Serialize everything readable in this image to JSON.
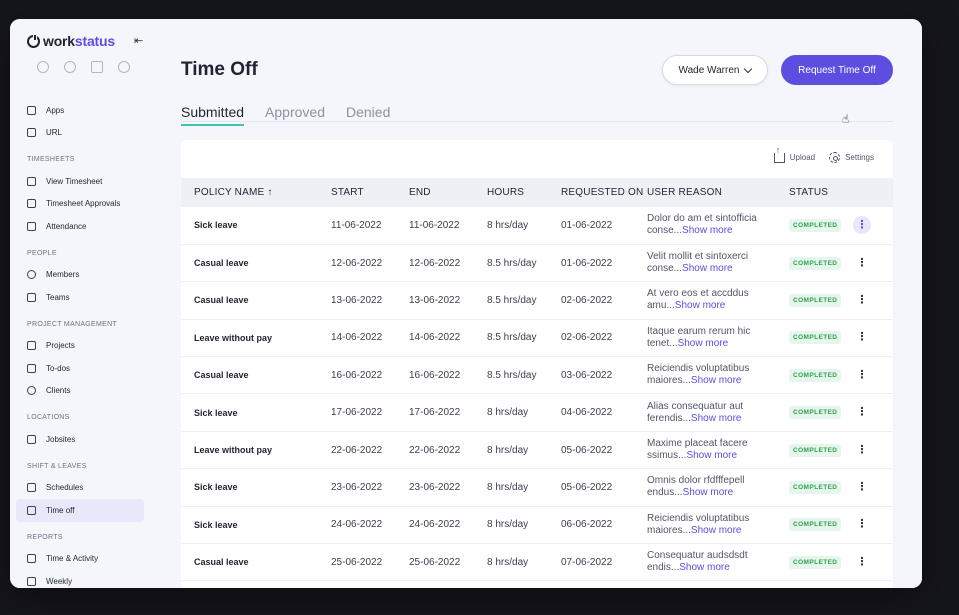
{
  "brand": {
    "name_prefix": "work",
    "name_suffix": "status"
  },
  "sidebar": {
    "top_items": [
      {
        "label": "Apps",
        "icon": "grid-icon"
      },
      {
        "label": "URL",
        "icon": "link-icon"
      }
    ],
    "sections": [
      {
        "title": "TIMESHEETS",
        "items": [
          "View Timesheet",
          "Timesheet Approvals",
          "Attendance"
        ]
      },
      {
        "title": "PEOPLE",
        "items": [
          "Members",
          "Teams"
        ]
      },
      {
        "title": "PROJECT MANAGEMENT",
        "items": [
          "Projects",
          "To-dos",
          "Clients"
        ]
      },
      {
        "title": "LOCATIONS",
        "items": [
          "Jobsites"
        ]
      },
      {
        "title": "SHIFT & LEAVES",
        "items": [
          "Schedules",
          "Time off"
        ]
      },
      {
        "title": "REPORTS",
        "items": [
          "Time & Activity",
          "Weekly"
        ]
      }
    ],
    "active_item": "Time off"
  },
  "header": {
    "title": "Time Off",
    "user_select": "Wade Warren",
    "request_button": "Request Time Off"
  },
  "tabs": [
    {
      "label": "Submitted",
      "active": true
    },
    {
      "label": "Approved",
      "active": false
    },
    {
      "label": "Denied",
      "active": false
    }
  ],
  "toolbar": {
    "upload": "Upload",
    "settings": "Settings"
  },
  "table": {
    "columns": [
      "POLICY NAME",
      "START",
      "END",
      "HOURS",
      "REQUESTED ON",
      "USER REASON",
      "STATUS"
    ],
    "sort_indicator": "↑",
    "rows": [
      {
        "policy": "Sick leave",
        "start": "11-06-2022",
        "end": "11-06-2022",
        "hours": "8 hrs/day",
        "requested": "01-06-2022",
        "reason1": "Dolor do am et sintofficia",
        "reason2": "conse...",
        "status": "COMPLETED"
      },
      {
        "policy": "Casual leave",
        "start": "12-06-2022",
        "end": "12-06-2022",
        "hours": "8.5 hrs/day",
        "requested": "01-06-2022",
        "reason1": "Velit mollit et sintoxerci",
        "reason2": "conse...",
        "status": "COMPLETED"
      },
      {
        "policy": "Casual leave",
        "start": "13-06-2022",
        "end": "13-06-2022",
        "hours": "8.5 hrs/day",
        "requested": "02-06-2022",
        "reason1": "At vero eos et accddus",
        "reason2": "amu...",
        "status": "COMPLETED"
      },
      {
        "policy": "Leave without pay",
        "start": "14-06-2022",
        "end": "14-06-2022",
        "hours": "8.5 hrs/day",
        "requested": "02-06-2022",
        "reason1": "Itaque earum rerum hic",
        "reason2": "tenet...",
        "status": "COMPLETED"
      },
      {
        "policy": "Casual leave",
        "start": "16-06-2022",
        "end": "16-06-2022",
        "hours": "8.5 hrs/day",
        "requested": "03-06-2022",
        "reason1": "Reiciendis voluptatibus",
        "reason2": "maiores...",
        "status": "COMPLETED"
      },
      {
        "policy": "Sick leave",
        "start": "17-06-2022",
        "end": "17-06-2022",
        "hours": "8 hrs/day",
        "requested": "04-06-2022",
        "reason1": "Alias consequatur aut",
        "reason2": "ferendis...",
        "status": "COMPLETED"
      },
      {
        "policy": "Leave without pay",
        "start": "22-06-2022",
        "end": "22-06-2022",
        "hours": "8 hrs/day",
        "requested": "05-06-2022",
        "reason1": "Maxime placeat facere",
        "reason2": "ssimus...",
        "status": "COMPLETED"
      },
      {
        "policy": "Sick leave",
        "start": "23-06-2022",
        "end": "23-06-2022",
        "hours": "8 hrs/day",
        "requested": "05-06-2022",
        "reason1": "Omnis dolor rfdfffepell",
        "reason2": "endus...",
        "status": "COMPLETED"
      },
      {
        "policy": "Sick leave",
        "start": "24-06-2022",
        "end": "24-06-2022",
        "hours": "8 hrs/day",
        "requested": "06-06-2022",
        "reason1": "Reiciendis voluptatibus",
        "reason2": "maiores...",
        "status": "COMPLETED"
      },
      {
        "policy": "Casual leave",
        "start": "25-06-2022",
        "end": "25-06-2022",
        "hours": "8 hrs/day",
        "requested": "07-06-2022",
        "reason1": "Consequatur audsdsdt",
        "reason2": "endis...",
        "status": "COMPLETED"
      }
    ],
    "show_more": "Show more",
    "row_menu": "⋮"
  },
  "colors": {
    "accent": "#5b4ee0",
    "tab_underline": "#43c3b2",
    "status_green": "#2fa14f"
  }
}
